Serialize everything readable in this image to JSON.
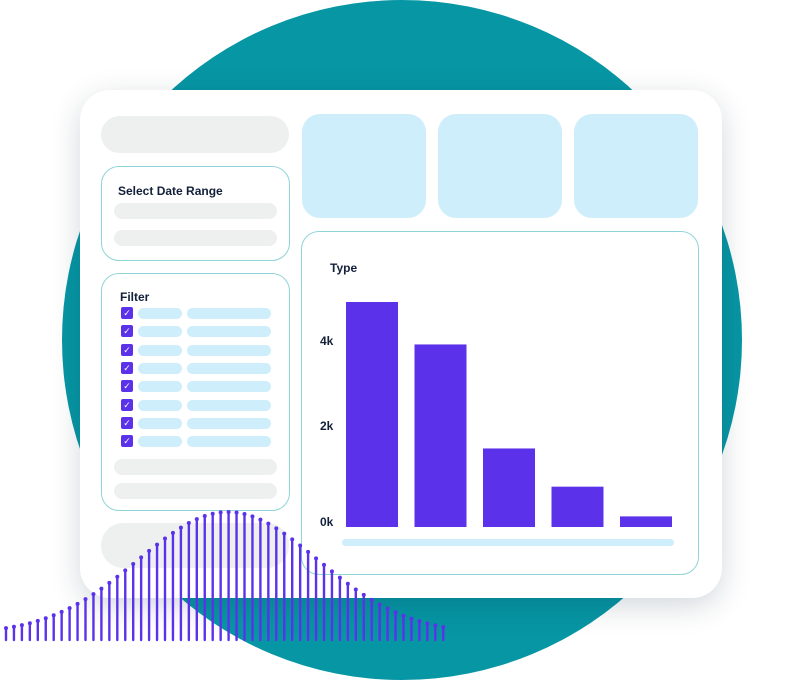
{
  "date_panel": {
    "title": "Select Date Range"
  },
  "filter_panel": {
    "title": "Filter",
    "option_count": 8
  },
  "chart_data": {
    "type": "bar",
    "title": "Type",
    "categories": [
      "",
      "",
      "",
      "",
      ""
    ],
    "values": [
      5300,
      4300,
      1850,
      950,
      250
    ],
    "yticks": [
      "0k",
      "2k",
      "4k"
    ],
    "ylim": [
      0,
      5300
    ],
    "bar_color": "#5b32ea"
  },
  "colors": {
    "circle": "#0796a4",
    "accent": "#5b32ea",
    "kpi": "#cdeefa",
    "placeholder": "#eef0f0",
    "border": "#8fd4d8"
  }
}
